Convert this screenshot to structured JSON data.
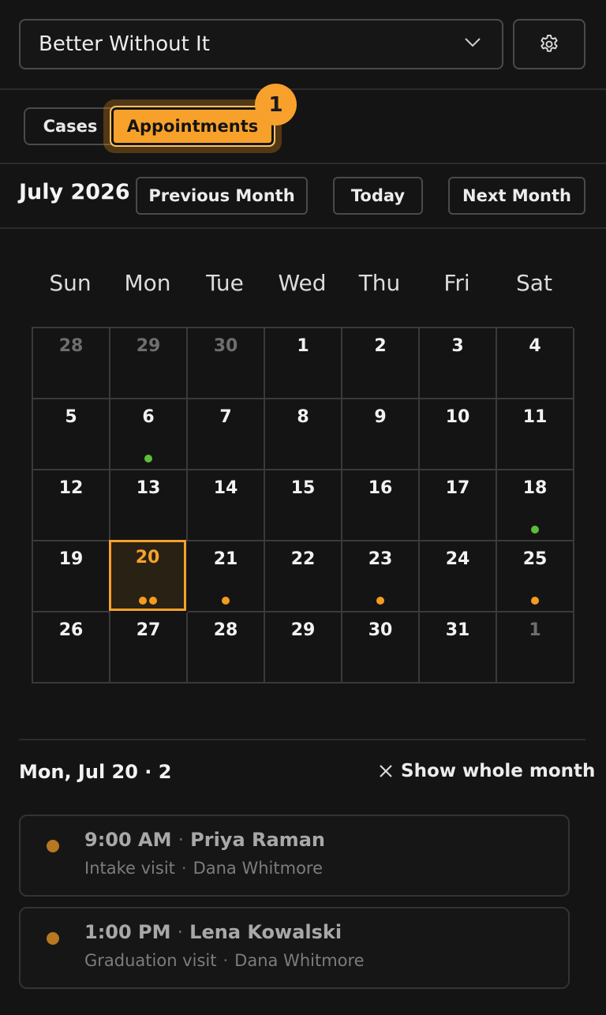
{
  "header": {
    "program": "Better Without It",
    "settings_icon": "gear-icon"
  },
  "tabs": [
    {
      "label": "Cases",
      "active": false
    },
    {
      "label": "Appointments",
      "active": true,
      "badge": "1"
    }
  ],
  "calendar": {
    "month_label": "July 2026",
    "prev_label": "Previous Month",
    "today_label": "Today",
    "next_label": "Next Month",
    "weekdays": [
      "Sun",
      "Mon",
      "Tue",
      "Wed",
      "Thu",
      "Fri",
      "Sat"
    ],
    "weeks": [
      [
        {
          "d": "28",
          "other": true
        },
        {
          "d": "29",
          "other": true
        },
        {
          "d": "30",
          "other": true
        },
        {
          "d": "1"
        },
        {
          "d": "2"
        },
        {
          "d": "3"
        },
        {
          "d": "4"
        }
      ],
      [
        {
          "d": "5"
        },
        {
          "d": "6",
          "dots": [
            "green"
          ]
        },
        {
          "d": "7"
        },
        {
          "d": "8"
        },
        {
          "d": "9"
        },
        {
          "d": "10"
        },
        {
          "d": "11"
        }
      ],
      [
        {
          "d": "12"
        },
        {
          "d": "13"
        },
        {
          "d": "14"
        },
        {
          "d": "15"
        },
        {
          "d": "16"
        },
        {
          "d": "17"
        },
        {
          "d": "18",
          "dots": [
            "green"
          ]
        }
      ],
      [
        {
          "d": "19"
        },
        {
          "d": "20",
          "selected": true,
          "dots": [
            "orange",
            "orange"
          ]
        },
        {
          "d": "21",
          "dots": [
            "orange"
          ]
        },
        {
          "d": "22"
        },
        {
          "d": "23",
          "dots": [
            "orange"
          ]
        },
        {
          "d": "24"
        },
        {
          "d": "25",
          "dots": [
            "orange"
          ]
        }
      ],
      [
        {
          "d": "26"
        },
        {
          "d": "27"
        },
        {
          "d": "28"
        },
        {
          "d": "29"
        },
        {
          "d": "30"
        },
        {
          "d": "31"
        },
        {
          "d": "1",
          "other": true
        }
      ]
    ],
    "dot_colors": {
      "green": "#5bbd3a",
      "orange": "#f39c1e"
    }
  },
  "day_detail": {
    "heading": "Mon, Jul 20 · 2",
    "show_month_label": "Show whole month",
    "appointments": [
      {
        "time": "9:00 AM",
        "client": "Priya Raman",
        "type": "Intake visit",
        "staff": "Dana Whitmore"
      },
      {
        "time": "1:00 PM",
        "client": "Lena Kowalski",
        "type": "Graduation visit",
        "staff": "Dana Whitmore"
      }
    ]
  },
  "colors": {
    "accent": "#f7a12c",
    "background": "#141414",
    "border": "#4a4a4a"
  }
}
